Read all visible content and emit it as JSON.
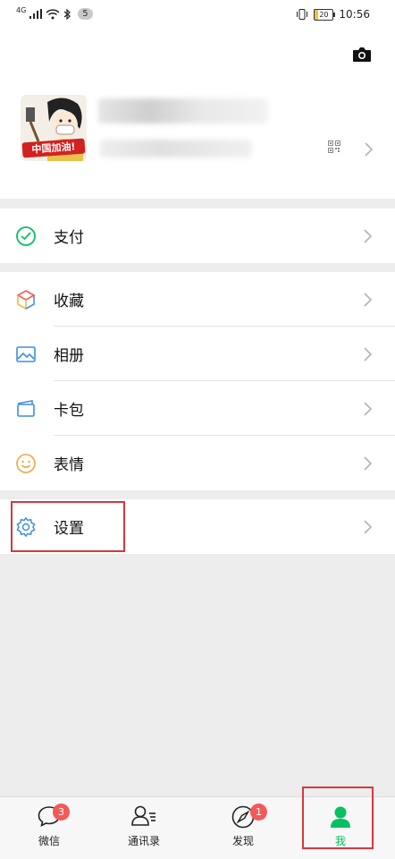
{
  "status_bar": {
    "network": "4G",
    "notification_count": "5",
    "battery": "20",
    "time": "10:56"
  },
  "profile": {
    "avatar_text": "中国加油!"
  },
  "menu": {
    "pay": "支付",
    "favorites": "收藏",
    "album": "相册",
    "cards": "卡包",
    "stickers": "表情",
    "settings": "设置"
  },
  "tabs": [
    {
      "label": "微信",
      "badge": "3"
    },
    {
      "label": "通讯录",
      "badge": ""
    },
    {
      "label": "发现",
      "badge": "1"
    },
    {
      "label": "我",
      "badge": ""
    }
  ],
  "colors": {
    "accent": "#07c160",
    "highlight": "#d9363e",
    "badge": "#f25a5a"
  }
}
